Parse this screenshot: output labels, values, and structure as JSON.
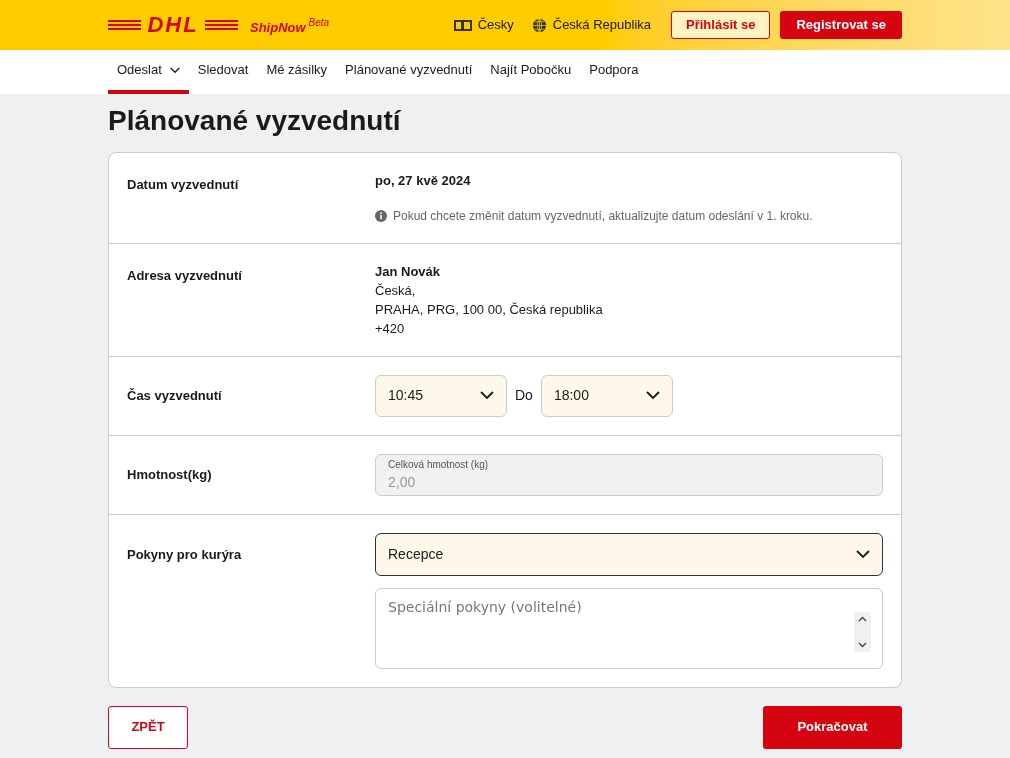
{
  "header": {
    "logo": "DHL",
    "product": "ShipNow",
    "badge": "Beta",
    "language": "Česky",
    "country": "Česká Republika",
    "login": "Přihlásit se",
    "register": "Registrovat se"
  },
  "nav": [
    {
      "label": "Odeslat",
      "selected": true,
      "dropdown": true
    },
    {
      "label": "Sledovat",
      "selected": false,
      "dropdown": false
    },
    {
      "label": "Mé zásilky",
      "selected": false,
      "dropdown": false
    },
    {
      "label": "Plánované vyzvednutí",
      "selected": false,
      "dropdown": false
    },
    {
      "label": "Najít Pobočku",
      "selected": false,
      "dropdown": false
    },
    {
      "label": "Podpora",
      "selected": false,
      "dropdown": false
    }
  ],
  "title": "Plánované vyzvednutí",
  "rows": [
    {
      "kind": "date",
      "label": "Datum vyzvednutí",
      "value": "po, 27 kvě 2024",
      "note": "Pokud chcete změnit datum vyzvednutí, aktualizujte datum odeslání v 1. kroku."
    },
    {
      "kind": "address",
      "label": "Adresa vyzvednutí",
      "name": "Jan Novák",
      "lines": [
        "Česká,",
        "PRAHA, PRG, 100 00, Česká republika",
        "+420"
      ]
    },
    {
      "kind": "time",
      "label": "Čas vyzvednutí",
      "from": "10:45",
      "separator": "Do",
      "to": "18:00"
    },
    {
      "kind": "weight",
      "label": "Hmotnost(kg)",
      "field_label": "Celková hmotnost (kg)",
      "value": "2,00",
      "disabled": true
    },
    {
      "kind": "instructions",
      "label": "Pokyny pro kurýra",
      "select": "Recepce",
      "placeholder": "Speciální pokyny (volitelné)"
    }
  ],
  "buttons": {
    "back": "ZPĚT",
    "continue": "Pokračovat"
  }
}
